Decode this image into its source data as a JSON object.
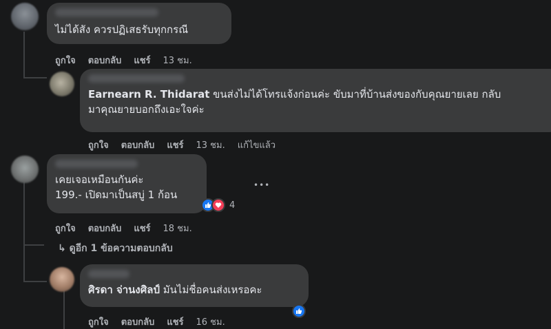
{
  "comments": [
    {
      "text": "ไม่ได้สัง ควรปฏิเสธรับทุกกรณี",
      "actions": {
        "like": "ถูกใจ",
        "reply": "ตอบกลับ",
        "share": "แชร์",
        "time": "13 ชม."
      }
    },
    {
      "author": "Earnearn R. Thidarat",
      "text_line1": "ขนส่งไม่ได้โทรแจ้งก่อนค่ะ ขับมาที่บ้านส่งของกับคุณยายเลย กลับ",
      "text_line2": "มาคุณยายบอกถึงเอะใจค่ะ",
      "actions": {
        "like": "ถูกใจ",
        "reply": "ตอบกลับ",
        "share": "แชร์",
        "time": "13 ชม.",
        "edited": "แก้ไขแล้ว"
      }
    },
    {
      "text_line1": "เคยเจอเหมือนกันค่ะ",
      "text_line2": "199.- เปิดมาเป็นสบู่ 1 ก้อน",
      "reaction_count": "4",
      "more": "•••",
      "actions": {
        "like": "ถูกใจ",
        "reply": "ตอบกลับ",
        "share": "แชร์",
        "time": "18 ชม."
      }
    },
    {
      "author": "ศิรดา จ่านงศิลป์",
      "text": "มันไม่ชื่อคนส่งเหรอคะ",
      "actions": {
        "like": "ถูกใจ",
        "reply": "ตอบกลับ",
        "share": "แชร์",
        "time": "16 ชม."
      }
    }
  ],
  "view_replies": {
    "arrow": "↳",
    "label": "ดูอีก 1 ข้อความตอบกลับ"
  },
  "colors": {
    "background": "#18191a",
    "bubble": "#3a3b3c",
    "secondary_text": "#b0b3b8",
    "like_blue": "#1877f2",
    "love_red": "#f33e58"
  },
  "icons": [
    "like-reaction-icon",
    "love-reaction-icon",
    "more-options-icon",
    "reply-arrow-icon"
  ]
}
